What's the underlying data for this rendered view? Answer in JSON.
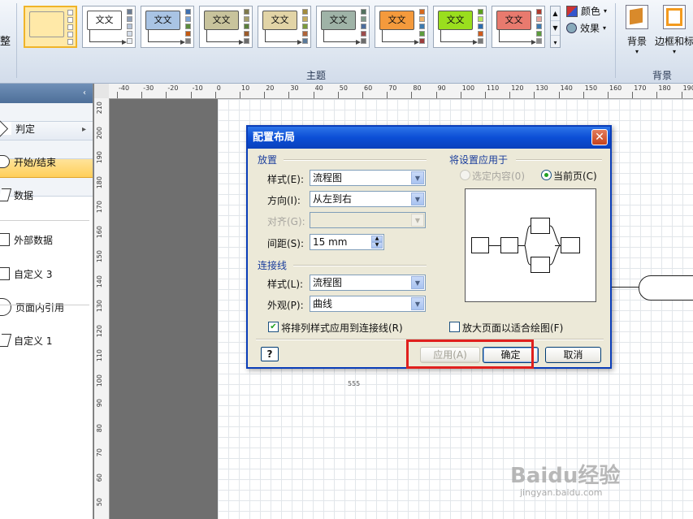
{
  "ribbon": {
    "left_fragment": "整",
    "theme_group_label": "主题",
    "background_group_label": "背景",
    "theme_card_text": "文文",
    "themes": [
      {
        "name": "blank",
        "card_bg": "#ffffff",
        "swatches": [
          "#ffffff",
          "#ffffff",
          "#ffffff",
          "#ffffff",
          "#ffffff"
        ]
      },
      {
        "name": "white",
        "card_bg": "#ffffff",
        "swatches": [
          "#6b7c93",
          "#8fa0b8",
          "#b4c2d6",
          "#d4dde9",
          "#eaeff5"
        ]
      },
      {
        "name": "blue",
        "card_bg": "#a9c4e4",
        "swatches": [
          "#3d6fb0",
          "#7aa3d6",
          "#5b8b3c",
          "#c55a11",
          "#7f7f7f"
        ]
      },
      {
        "name": "olive",
        "card_bg": "#c8c39c",
        "swatches": [
          "#7f7a4c",
          "#a59f6a",
          "#5b7f3c",
          "#9c5b2a",
          "#6b6b6b"
        ]
      },
      {
        "name": "tan",
        "card_bg": "#e2d4a6",
        "swatches": [
          "#a38b3c",
          "#c7ad5c",
          "#7a9a3c",
          "#b0653a",
          "#5a7a9a"
        ]
      },
      {
        "name": "grey-green",
        "card_bg": "#9fb3a7",
        "swatches": [
          "#52705e",
          "#7c9888",
          "#4c6c9c",
          "#9c4c4c",
          "#6c6c6c"
        ]
      },
      {
        "name": "orange",
        "card_bg": "#f49a3c",
        "swatches": [
          "#d6691c",
          "#f0b266",
          "#3c7ab0",
          "#5c9c3c",
          "#9c3c3c"
        ]
      },
      {
        "name": "green",
        "card_bg": "#9ade1e",
        "swatches": [
          "#5aa01c",
          "#b4e65c",
          "#2c6cb0",
          "#d05a1c",
          "#7a7a7a"
        ]
      },
      {
        "name": "red",
        "card_bg": "#e87a6e",
        "swatches": [
          "#b0392c",
          "#e8a49c",
          "#3c7ab0",
          "#5c9c3c",
          "#8a8a8a"
        ]
      }
    ],
    "colors_label": "颜色",
    "effects_label": "效果",
    "background_button_label": "背景",
    "border_title_label": "边框和标"
  },
  "shapes_panel": {
    "collapse_glyph": "‹",
    "expand_glyph": "▸",
    "items": [
      {
        "label": "判定",
        "shape": "diamond"
      },
      {
        "label": "开始/结束",
        "shape": "pill"
      },
      {
        "label": "数据",
        "shape": "para"
      },
      {
        "label": "外部数据",
        "shape": "rect"
      },
      {
        "label": "自定义 3",
        "shape": "rect"
      },
      {
        "label": "页面内引用",
        "shape": "round"
      },
      {
        "label": "自定义 1",
        "shape": "para"
      }
    ]
  },
  "ruler": {
    "h_labels": [
      "-40",
      "-30",
      "-20",
      "-10",
      "0",
      "10",
      "20",
      "30",
      "40",
      "50",
      "60",
      "70",
      "80",
      "90",
      "100",
      "110",
      "120",
      "130",
      "140",
      "150",
      "160",
      "170",
      "180",
      "190"
    ],
    "v_labels": [
      "210",
      "200",
      "190",
      "180",
      "170",
      "160",
      "150",
      "140",
      "130",
      "120",
      "110",
      "100",
      "90",
      "80",
      "70",
      "60",
      "50"
    ]
  },
  "canvas": {
    "page_number": "555"
  },
  "dialog": {
    "title": "配置布局",
    "close_glyph": "✕",
    "placement": {
      "section": "放置",
      "style_label": "样式(E):",
      "style_value": "流程图",
      "direction_label": "方向(I):",
      "direction_value": "从左到右",
      "align_label": "对齐(G):",
      "align_value": "",
      "spacing_label": "间距(S):",
      "spacing_value": "15 mm"
    },
    "connectors": {
      "section": "连接线",
      "style_label": "样式(L):",
      "style_value": "流程图",
      "appearance_label": "外观(P):",
      "appearance_value": "曲线",
      "apply_routing_label": "将排列样式应用到连接线(R)",
      "apply_routing_checked": true
    },
    "apply_to": {
      "section": "将设置应用于",
      "selection_label": "选定内容(0)",
      "current_page_label": "当前页(C)",
      "selected": "current_page"
    },
    "enlarge_page_label": "放大页面以适合绘图(F)",
    "enlarge_page_checked": false,
    "help_glyph": "?",
    "buttons": {
      "apply": "应用(A)",
      "ok": "确定",
      "cancel": "取消"
    },
    "highlight_color": "#e0201e"
  },
  "watermark": {
    "text": "Baidu经验",
    "sub": "jingyan.baidu.com"
  }
}
